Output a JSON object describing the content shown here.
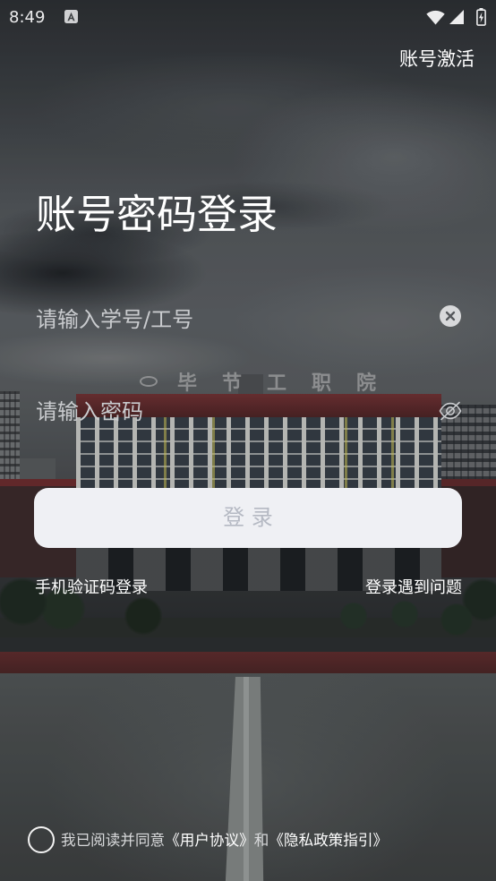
{
  "status_bar": {
    "time": "8:49",
    "icons": [
      "notification-app-icon",
      "wifi-icon",
      "signal-icon",
      "battery-charging-icon"
    ]
  },
  "header": {
    "activate_label": "账号激活"
  },
  "login": {
    "title": "账号密码登录",
    "username": {
      "placeholder": "请输入学号/工号",
      "action_icon": "clear-icon"
    },
    "password": {
      "placeholder": "请输入密码",
      "action_icon": "eye-off-icon"
    },
    "submit_label": "登 录",
    "sms_login_label": "手机验证码登录",
    "help_label": "登录遇到问题"
  },
  "agreement": {
    "checked": false,
    "prefix": "我已阅读并同意",
    "user_agreement": "《用户协议》",
    "conjunction": "和",
    "privacy_policy": "《隐私政策指引》"
  },
  "background": {
    "sign_text": "毕节工职院"
  },
  "colors": {
    "text": "#ffffff",
    "placeholder": "#c9cbce",
    "button_bg": "#eff0f4",
    "button_text": "#b5b9c3"
  }
}
